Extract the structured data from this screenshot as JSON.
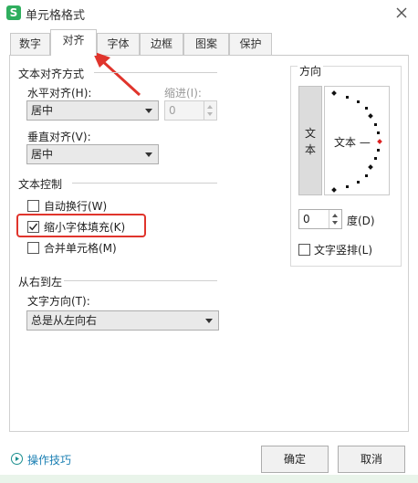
{
  "window": {
    "title": "单元格格式",
    "app_icon_letter": "S",
    "accent": "#2fae5e"
  },
  "tabs": [
    {
      "label": "数字",
      "active": false
    },
    {
      "label": "对齐",
      "active": true
    },
    {
      "label": "字体",
      "active": false
    },
    {
      "label": "边框",
      "active": false
    },
    {
      "label": "图案",
      "active": false
    },
    {
      "label": "保护",
      "active": false
    }
  ],
  "text_align": {
    "section_title": "文本对齐方式",
    "horizontal_label": "水平对齐(H):",
    "horizontal_value": "居中",
    "indent_label": "缩进(I):",
    "indent_value": "0",
    "vertical_label": "垂直对齐(V):",
    "vertical_value": "居中"
  },
  "text_control": {
    "section_title": "文本控制",
    "wrap_text": {
      "label": "自动换行(W)",
      "checked": false
    },
    "shrink_to_fit": {
      "label": "缩小字体填充(K)",
      "checked": true
    },
    "merge_cells": {
      "label": "合并单元格(M)",
      "checked": false
    }
  },
  "rtl": {
    "section_title": "从右到左",
    "direction_label": "文字方向(T):",
    "direction_value": "总是从左向右"
  },
  "orientation": {
    "section_title": "方向",
    "vertical_text": "文本",
    "dial_text": "文本 —",
    "degree_value": "0",
    "degree_label": "度(D)",
    "vertical_stack": {
      "label": "文字竖排(L)",
      "checked": false
    }
  },
  "footer": {
    "tips_label": "操作技巧",
    "ok_label": "确定",
    "cancel_label": "取消"
  },
  "annotation": {
    "color": "#e0342c"
  }
}
